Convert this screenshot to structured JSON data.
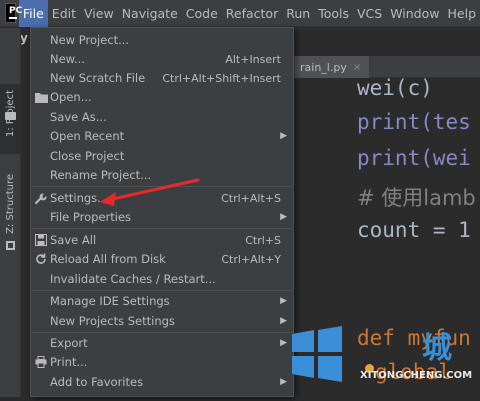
{
  "menubar": {
    "app_icon_label": "PC",
    "items": [
      {
        "label": "File"
      },
      {
        "label": "Edit"
      },
      {
        "label": "View"
      },
      {
        "label": "Navigate"
      },
      {
        "label": "Code"
      },
      {
        "label": "Refactor"
      },
      {
        "label": "Run"
      },
      {
        "label": "Tools"
      },
      {
        "label": "VCS"
      },
      {
        "label": "Window"
      },
      {
        "label": "Help"
      }
    ]
  },
  "project_crumb": "Py",
  "side_tabs": {
    "project": "1: Project",
    "structure": "Z: Structure"
  },
  "editor": {
    "tab_label": "rain_l.py",
    "lines": [
      "wei(c)",
      "print(tes",
      "print(wei",
      "# 使用lamb",
      "count = 1",
      "def  myfun",
      "global"
    ]
  },
  "file_menu": {
    "items": [
      {
        "label": "New Project...",
        "shortcut": "",
        "icon": "",
        "submenu": false
      },
      {
        "label": "New...",
        "shortcut": "Alt+Insert",
        "icon": "",
        "submenu": false
      },
      {
        "label": "New Scratch File",
        "shortcut": "Ctrl+Alt+Shift+Insert",
        "icon": "",
        "submenu": false
      },
      {
        "label": "Open...",
        "shortcut": "",
        "icon": "folder-icon",
        "submenu": false
      },
      {
        "label": "Save As...",
        "shortcut": "",
        "icon": "",
        "submenu": false
      },
      {
        "label": "Open Recent",
        "shortcut": "",
        "icon": "",
        "submenu": true
      },
      {
        "label": "Close Project",
        "shortcut": "",
        "icon": "",
        "submenu": false
      },
      {
        "label": "Rename Project...",
        "shortcut": "",
        "icon": "",
        "submenu": false
      },
      {
        "label": "Settings...",
        "shortcut": "Ctrl+Alt+S",
        "icon": "wrench-icon",
        "submenu": false
      },
      {
        "label": "File Properties",
        "shortcut": "",
        "icon": "",
        "submenu": true
      },
      {
        "label": "Save All",
        "shortcut": "Ctrl+S",
        "icon": "save-icon",
        "submenu": false
      },
      {
        "label": "Reload All from Disk",
        "shortcut": "Ctrl+Alt+Y",
        "icon": "reload-icon",
        "submenu": false
      },
      {
        "label": "Invalidate Caches / Restart...",
        "shortcut": "",
        "icon": "",
        "submenu": false
      },
      {
        "label": "Manage IDE Settings",
        "shortcut": "",
        "icon": "",
        "submenu": true
      },
      {
        "label": "New Projects Settings",
        "shortcut": "",
        "icon": "",
        "submenu": true
      },
      {
        "label": "Export",
        "shortcut": "",
        "icon": "",
        "submenu": true
      },
      {
        "label": "Print...",
        "shortcut": "",
        "icon": "print-icon",
        "submenu": false
      },
      {
        "label": "Add to Favorites",
        "shortcut": "",
        "icon": "",
        "submenu": true
      }
    ]
  },
  "watermark": {
    "brand": "XITONGCHENG.COM"
  },
  "colors": {
    "menu_bg": "#3c3f41",
    "active": "#4b6eaf",
    "arrow": "#e8292c"
  }
}
